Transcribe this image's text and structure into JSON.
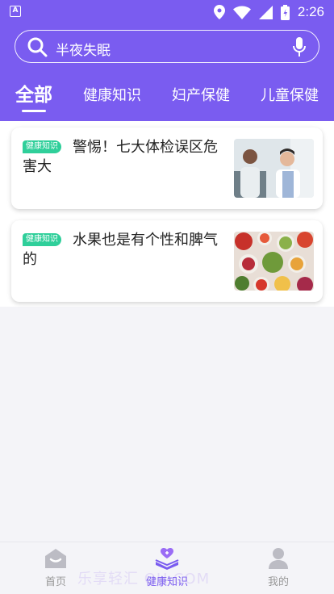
{
  "statusbar": {
    "time": "2:26",
    "app_glyph": "A"
  },
  "search": {
    "placeholder": "半夜失眠"
  },
  "tabs": [
    {
      "label": "全部",
      "active": true
    },
    {
      "label": "健康知识"
    },
    {
      "label": "妇产保健"
    },
    {
      "label": "儿童保健"
    }
  ],
  "articles": [
    {
      "badge": "健康知识",
      "title": "警惕！七大体检误区危害大"
    },
    {
      "badge": "健康知识",
      "title": "水果也是有个性和脾气的"
    }
  ],
  "bottom_nav": [
    {
      "label": "首页",
      "icon": "home-icon"
    },
    {
      "label": "健康知识",
      "icon": "health-book-icon",
      "active": true
    },
    {
      "label": "我的",
      "icon": "person-icon"
    }
  ],
  "watermark": "乐享轻汇 QH.COM",
  "colors": {
    "accent": "#7a5cf0",
    "badge": "#2fcf9a",
    "background": "#f4f4f8"
  }
}
